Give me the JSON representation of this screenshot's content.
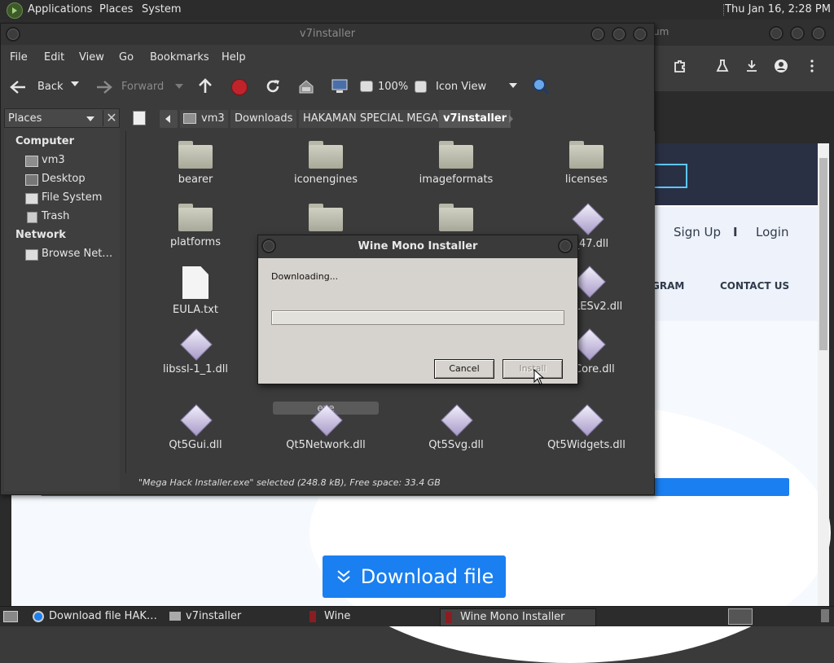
{
  "top_panel": {
    "menus": [
      "Applications",
      "Places",
      "System"
    ],
    "clock": "Thu Jan 16,  2:28 PM"
  },
  "browser": {
    "title_tail": "um",
    "nav": {
      "sign_up": "Sign Up",
      "separator": "I",
      "login": "Login",
      "program": "GRAM",
      "contact": "CONTACT US"
    },
    "download_button": "Download file",
    "colors": {
      "accent": "#1a7ff0",
      "header": "#2a3044"
    }
  },
  "file_manager": {
    "title": "v7installer",
    "menubar": [
      "File",
      "Edit",
      "View",
      "Go",
      "Bookmarks",
      "Help"
    ],
    "toolbar": {
      "back": "Back",
      "forward": "Forward",
      "zoom": "100%",
      "view_mode": "Icon View"
    },
    "path": [
      "vm3",
      "Downloads",
      "HAKAMAN SPECIAL MEGA",
      "v7installer"
    ],
    "sidebar": {
      "header": "Places",
      "sections": [
        {
          "title": "Computer",
          "items": [
            "vm3",
            "Desktop",
            "File System",
            "Trash"
          ]
        },
        {
          "title": "Network",
          "items": [
            "Browse Net…"
          ]
        }
      ]
    },
    "files": [
      {
        "name": "bearer",
        "type": "folder"
      },
      {
        "name": "iconengines",
        "type": "folder"
      },
      {
        "name": "imageformats",
        "type": "folder"
      },
      {
        "name": "licenses",
        "type": "folder"
      },
      {
        "name": "platforms",
        "type": "folder"
      },
      {
        "name": "",
        "type": "folder"
      },
      {
        "name": "",
        "type": "folder"
      },
      {
        "name": "mpiler_47.dll",
        "type": "dll"
      },
      {
        "name": "EULA.txt",
        "type": "text"
      },
      {
        "name": "LESv2.dll",
        "type": "dll"
      },
      {
        "name": "libssl-1_1.dll",
        "type": "dll"
      },
      {
        "name": "exe",
        "type": "selected"
      },
      {
        "name": "Core.dll",
        "type": "dll"
      },
      {
        "name": "Qt5Gui.dll",
        "type": "dll"
      },
      {
        "name": "Qt5Network.dll",
        "type": "dll"
      },
      {
        "name": "Qt5Svg.dll",
        "type": "dll"
      },
      {
        "name": "Qt5Widgets.dll",
        "type": "dll"
      }
    ],
    "status": "\"Mega Hack Installer.exe\" selected (248.8 kB), Free space: 33.4 GB"
  },
  "dialog": {
    "title": "Wine Mono Installer",
    "status": "Downloading...",
    "progress": 0,
    "cancel": "Cancel",
    "install": "Install"
  },
  "taskbar": {
    "items": [
      "Download file HAK…",
      "v7installer",
      "Wine",
      "Wine Mono Installer"
    ]
  }
}
